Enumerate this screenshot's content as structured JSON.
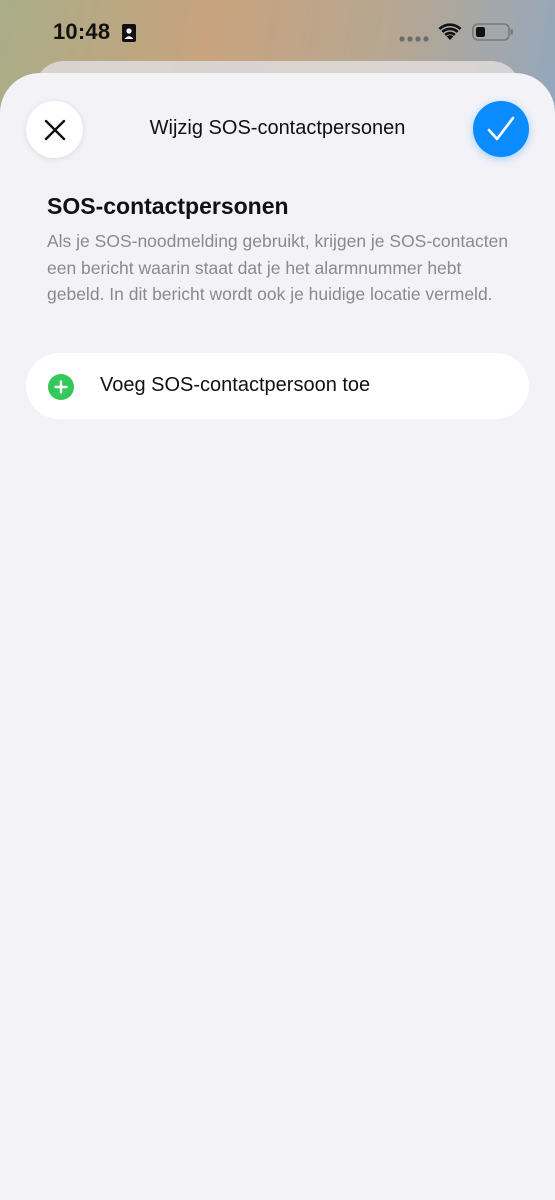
{
  "status_bar": {
    "time": "10:48"
  },
  "nav": {
    "title": "Wijzig SOS-contactpersonen",
    "close_icon": "close-icon",
    "confirm_icon": "checkmark-icon"
  },
  "section": {
    "title": "SOS-contactpersonen",
    "description": "Als je SOS-noodmelding gebruikt, krijgen je SOS-contacten een bericht waarin staat dat je het alarmnummer hebt gebeld. In dit bericht wordt ook je huidige locatie vermeld."
  },
  "add_contact": {
    "label": "Voeg SOS-contactpersoon toe",
    "icon": "plus-circle-icon"
  },
  "colors": {
    "accent": "#0A8CFF",
    "add_green": "#34C759",
    "sheet_background": "#F2F2F7",
    "secondary_text": "#8A8A8E"
  }
}
